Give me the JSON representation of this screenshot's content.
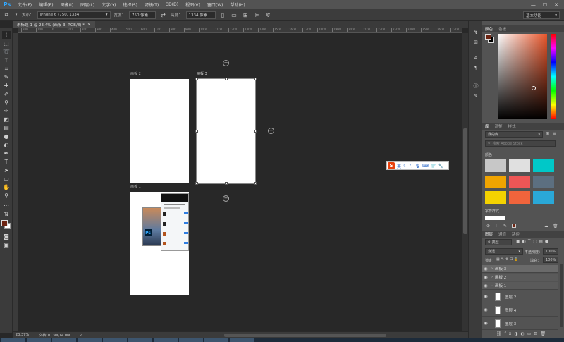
{
  "app": {
    "logo": "Ps"
  },
  "menu": [
    "文件(F)",
    "编辑(E)",
    "图像(I)",
    "图层(L)",
    "文字(Y)",
    "选择(S)",
    "滤镜(T)",
    "3D(D)",
    "视图(V)",
    "窗口(W)",
    "帮助(H)"
  ],
  "window_controls": {
    "minimize": "—",
    "maximize": "☐",
    "close": "✕"
  },
  "options": {
    "size_label": "大小：",
    "size_value": "iPhone 6 (750, 1334)",
    "width_label": "宽度：",
    "width_value": "750 像素",
    "height_label": "高度：",
    "height_value": "1334 像素",
    "workspace": "基本功能"
  },
  "document": {
    "tab_title": "未标题-1 @ 23.4% (画板 3, RGB/8) *",
    "close": "×"
  },
  "ruler_numbers": [
    "200",
    "100",
    "0",
    "100",
    "200",
    "300",
    "400",
    "500",
    "600",
    "700",
    "800",
    "900",
    "1000",
    "1100",
    "1200",
    "1300",
    "1400",
    "1500",
    "1600",
    "1700",
    "1800",
    "1900",
    "2000",
    "2100",
    "2200",
    "2300",
    "2400",
    "2500",
    "2600",
    "2700"
  ],
  "artboards": {
    "a2": "画板 2",
    "a3": "画板 3",
    "a1": "画板 1"
  },
  "artboard_add": "+",
  "status": {
    "zoom": "23.37%",
    "doc": "文档:10.3M/14.0M",
    "arrow": ">"
  },
  "ime": {
    "logo": "S",
    "lang": "英"
  },
  "color_panel": {
    "tabs": [
      "颜色",
      "色板"
    ]
  },
  "library_panel": {
    "tabs": [
      "库",
      "调整",
      "样式"
    ],
    "library_select": "我的库",
    "search_placeholder": "搜索 Adobe Stock",
    "colors_label": "颜色",
    "char_styles_label": "字符样式",
    "swatches": [
      "#c7c7c7",
      "#e0e0e0",
      "#00c8c8",
      "#f0a400",
      "#ee5656",
      "#5c6f80",
      "#f4d200",
      "#f0643c",
      "#2aa8d8"
    ]
  },
  "layers_panel": {
    "tabs": [
      "图层",
      "通道",
      "路径"
    ],
    "filter_label": "类型",
    "blend_mode": "穿透",
    "opacity_label": "不透明度：",
    "opacity_value": "100%",
    "lock_label": "锁定：",
    "fill_label": "填充：",
    "fill_value": "100%",
    "layers": [
      {
        "name": "画板 3",
        "kind": "group",
        "selected": true
      },
      {
        "name": "画板 2",
        "kind": "group"
      },
      {
        "name": "画板 1",
        "kind": "group"
      },
      {
        "name": "图层 2",
        "kind": "layer"
      },
      {
        "name": "图层 4",
        "kind": "layer"
      },
      {
        "name": "图层 3",
        "kind": "layer"
      }
    ]
  }
}
